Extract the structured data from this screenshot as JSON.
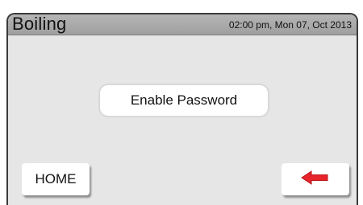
{
  "header": {
    "title": "Boiling",
    "datetime": "02:00 pm, Mon 07, Oct 2013"
  },
  "main": {
    "enable_password_label": "Enable Password"
  },
  "footer": {
    "home_label": "HOME",
    "back_icon": "left-arrow-icon",
    "back_icon_color": "#e8242b"
  },
  "colors": {
    "title_bar": "#a9a9a9",
    "panel_background": "#e6e6e6",
    "border": "#3a3a3a"
  }
}
